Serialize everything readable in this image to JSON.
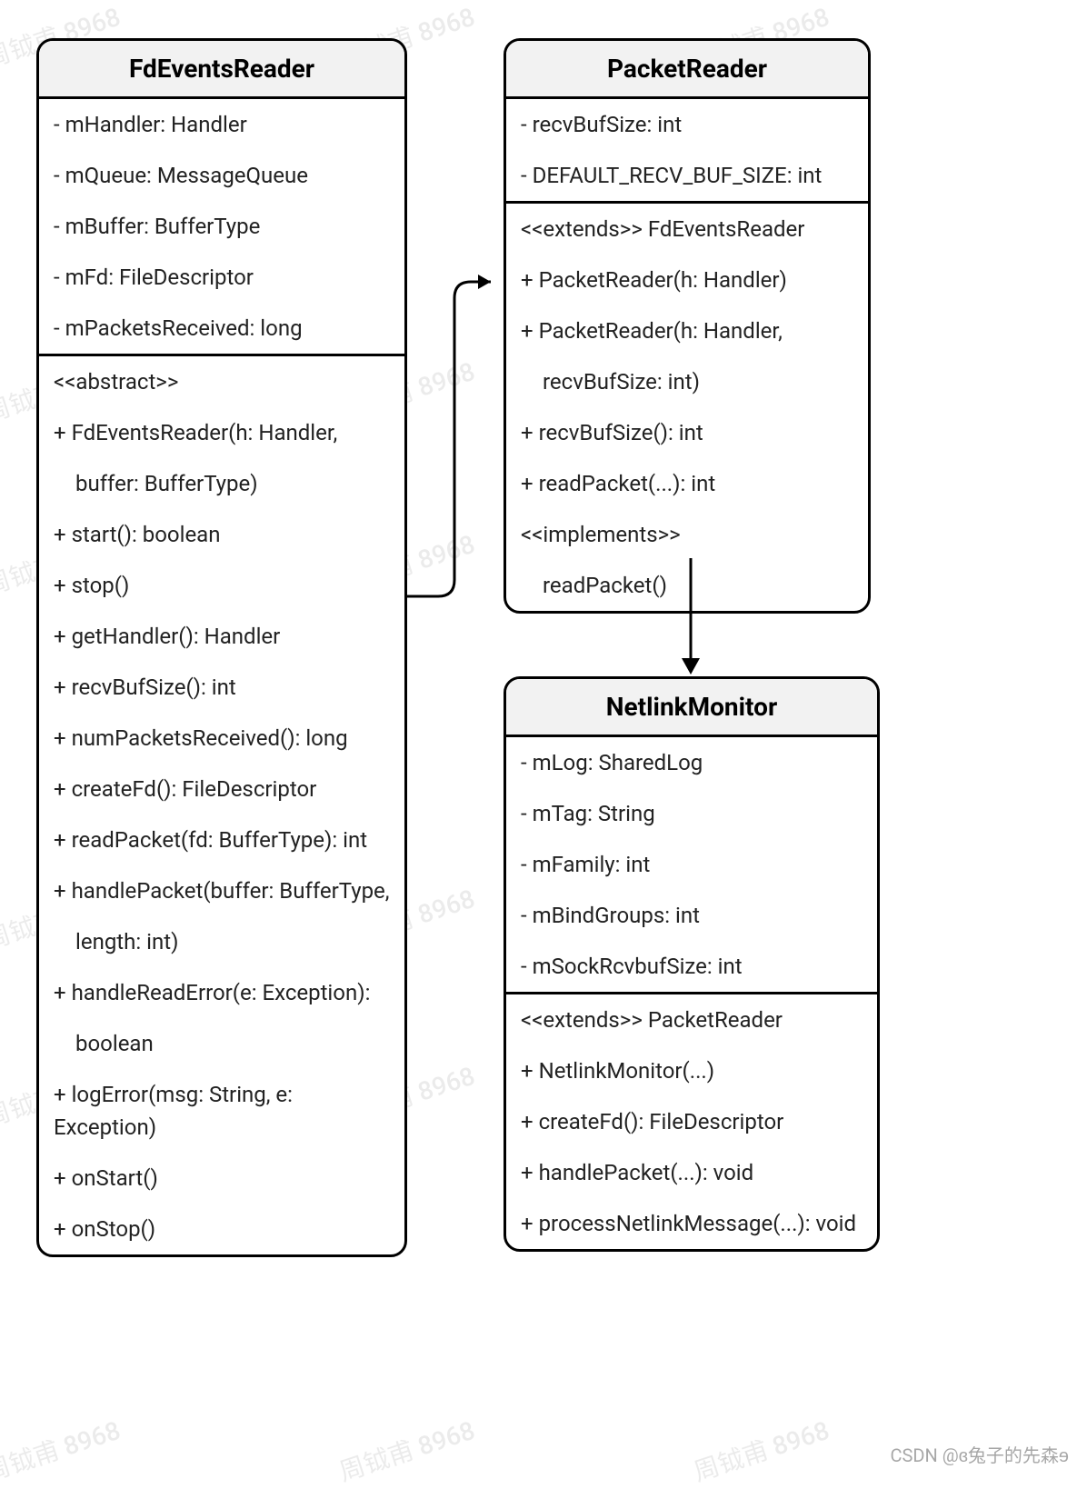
{
  "watermark_text": "周钺甫 8968",
  "footer_credit": "CSDN @ɞ兔子的先森ɘ",
  "classes": {
    "fd": {
      "title": "FdEventsReader",
      "attrs": [
        "- mHandler: Handler",
        "- mQueue: MessageQueue",
        "- mBuffer: BufferType",
        "- mFd: FileDescriptor",
        "- mPacketsReceived: long"
      ],
      "ops_header": "<<abstract>>",
      "ops": [
        "+ FdEventsReader(h: Handler,",
        "buffer: BufferType)",
        "+ start(): boolean",
        "+ stop()",
        "+ getHandler(): Handler",
        "+ recvBufSize(): int",
        "+ numPacketsReceived(): long",
        "+ createFd(): FileDescriptor",
        "+ readPacket(fd: BufferType): int",
        "+ handlePacket(buffer: BufferType,",
        "length: int)",
        "+ handleReadError(e: Exception):",
        "boolean",
        " + logError(msg: String, e: Exception)",
        "+ onStart()",
        "+ onStop()"
      ]
    },
    "pr": {
      "title": "PacketReader",
      "attrs": [
        "- recvBufSize: int",
        "- DEFAULT_RECV_BUF_SIZE: int"
      ],
      "ops": [
        "<<extends>> FdEventsReader",
        "+ PacketReader(h: Handler)",
        "+ PacketReader(h: Handler,",
        "recvBufSize: int)",
        "+ recvBufSize(): int",
        "+ readPacket(...): int",
        "<<implements>>",
        "readPacket()"
      ]
    },
    "nm": {
      "title": "NetlinkMonitor",
      "attrs": [
        "- mLog: SharedLog",
        "- mTag: String",
        "- mFamily: int",
        "- mBindGroups: int",
        "- mSockRcvbufSize: int"
      ],
      "ops": [
        "<<extends>> PacketReader",
        "+ NetlinkMonitor(...)",
        "+ createFd(): FileDescriptor",
        "+ handlePacket(...): void",
        "+ processNetlinkMessage(...): void"
      ]
    }
  }
}
